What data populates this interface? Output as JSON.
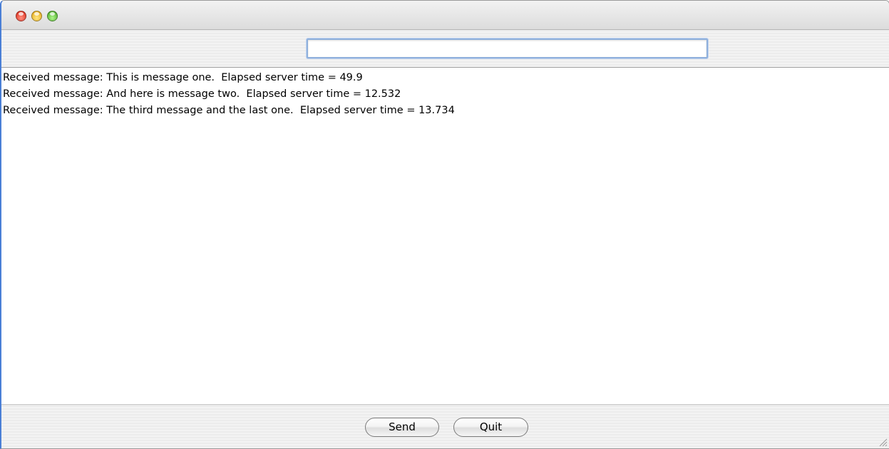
{
  "window": {
    "controls": [
      "close-button",
      "minimize-button",
      "zoom-button"
    ]
  },
  "input": {
    "value": "",
    "placeholder": ""
  },
  "log": {
    "lines": [
      "Received message: This is message one.  Elapsed server time = 49.9",
      "Received message: And here is message two.  Elapsed server time = 12.532",
      "Received message: The third message and the last one.  Elapsed server time = 13.734"
    ]
  },
  "buttons": {
    "send_label": "Send",
    "quit_label": "Quit"
  },
  "colors": {
    "accent_border": "#4a7fd6",
    "input_focus": "#8fb0dc",
    "close": "#d81e0c",
    "minimize": "#e2a20b",
    "zoom": "#3da11a"
  }
}
